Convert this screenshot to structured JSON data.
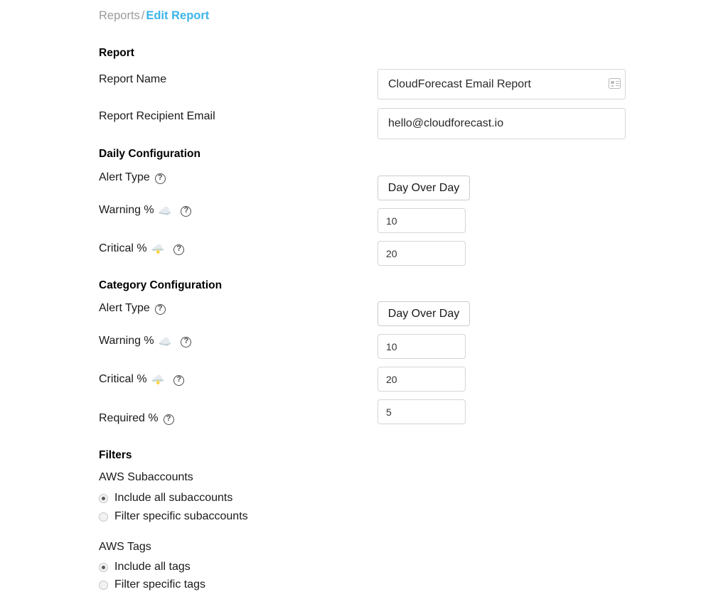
{
  "breadcrumb": {
    "parent": "Reports",
    "separator": "/",
    "current": "Edit Report"
  },
  "report_section": {
    "heading": "Report",
    "name_label": "Report Name",
    "name_value": "CloudForecast Email Report",
    "name_placeholder": "Report Name",
    "name_autofill_icon": "contact-card-icon",
    "email_label": "Report Recipient Email",
    "email_value": "hello@cloudforecast.io",
    "email_placeholder": "Report Recipient Email"
  },
  "daily_section": {
    "heading": "Daily Configuration",
    "alert_type_label": "Alert Type",
    "alert_type_value": "Day Over Day",
    "warning_label": "Warning %",
    "warning_icon": "cloud-emoji",
    "warning_value": "10",
    "critical_label": "Critical %",
    "critical_icon": "cloud-with-lightning-emoji",
    "critical_value": "20"
  },
  "category_section": {
    "heading": "Category Configuration",
    "alert_type_label": "Alert Type",
    "alert_type_value": "Day Over Day",
    "warning_label": "Warning %",
    "warning_icon": "cloud-emoji",
    "warning_value": "10",
    "critical_label": "Critical %",
    "critical_icon": "cloud-with-lightning-emoji",
    "critical_value": "20",
    "required_label": "Required %",
    "required_value": "5"
  },
  "filters_section": {
    "heading": "Filters",
    "subaccounts": {
      "group_label": "AWS Subaccounts",
      "options": [
        {
          "label": "Include all subaccounts",
          "selected": true
        },
        {
          "label": "Filter specific subaccounts",
          "selected": false
        }
      ]
    },
    "tags": {
      "group_label": "AWS Tags",
      "options": [
        {
          "label": "Include all tags",
          "selected": true
        },
        {
          "label": "Filter specific tags",
          "selected": false
        }
      ]
    }
  },
  "icons": {
    "help": "?",
    "cloud": "☁️",
    "cloud_lightning": "🌩️"
  },
  "colors": {
    "link_accent": "#3cb5e8",
    "breadcrumb_muted": "#9b9b9b",
    "input_border": "#d6d6d6",
    "text": "#1a1a1a",
    "background": "#ffffff"
  }
}
